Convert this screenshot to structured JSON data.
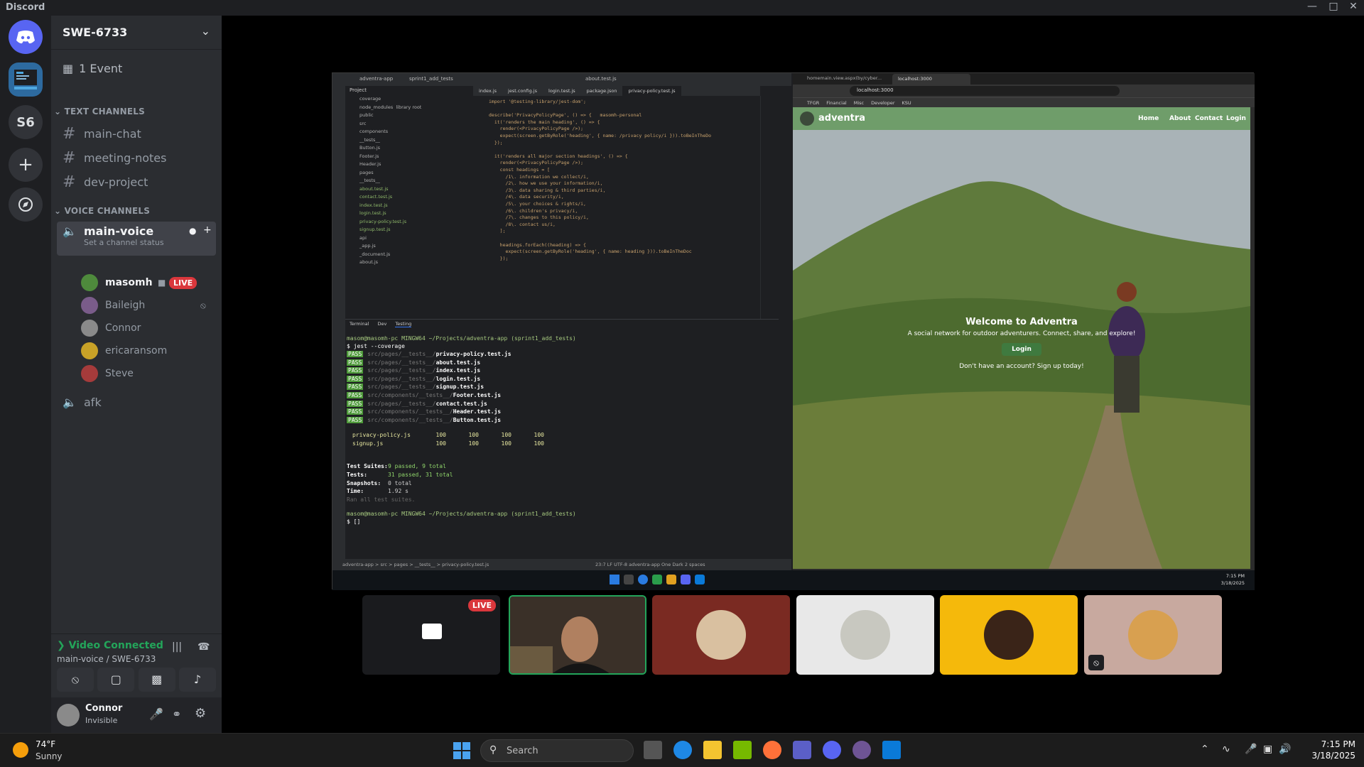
{
  "window": {
    "title": "Discord"
  },
  "server": {
    "name": "SWE-6733",
    "rail_label": "S6",
    "events": "1 Event"
  },
  "sidebar": {
    "text_category": "TEXT CHANNELS",
    "text_channels": [
      {
        "name": "main-chat"
      },
      {
        "name": "meeting-notes"
      },
      {
        "name": "dev-project"
      }
    ],
    "voice_category": "VOICE CHANNELS",
    "voice_channel": {
      "name": "main-voice",
      "status": "Set a channel status"
    },
    "members": [
      {
        "name": "masomh",
        "live": "LIVE",
        "color": "#4e8a3c"
      },
      {
        "name": "Baileigh",
        "color": "#7a5c8a"
      },
      {
        "name": "Connor",
        "color": "#8a8a8a"
      },
      {
        "name": "ericaransom",
        "color": "#c9a227"
      },
      {
        "name": "Steve",
        "color": "#a53b3b"
      }
    ],
    "afk_channel": "afk"
  },
  "voice": {
    "status": "Video Connected",
    "location": "main-voice / SWE-6733",
    "status_color": "#23a55a"
  },
  "user": {
    "name": "Connor",
    "status": "Invisible"
  },
  "ide": {
    "project": "adventra-app",
    "branch": "sprint1_add_tests",
    "run_config": "about.test.js",
    "tabs": [
      "index.js",
      "jest.config.js",
      "login.test.js",
      "package.json",
      "privacy-policy.test.js"
    ],
    "tree": [
      "coverage",
      "node_modules  library root",
      "public",
      "src",
      "components",
      "__tests__",
      "Button.js",
      "Footer.js",
      "Header.js",
      "pages",
      "__tests__",
      "about.test.js",
      "contact.test.js",
      "index.test.js",
      "login.test.js",
      "privacy-policy.test.js",
      "signup.test.js",
      "api",
      "_app.js",
      "_document.js",
      "about.js"
    ],
    "code": [
      "import '@testing-library/jest-dom';",
      "",
      "describe('PrivacyPolicyPage', () => {   masomh-personal",
      "  it('renders the main heading', () => {",
      "    render(<PrivacyPolicyPage />);",
      "    expect(screen.getByRole('heading', { name: /privacy policy/i })).toBeInTheDo",
      "  });",
      "",
      "  it('renders all major section headings', () => {",
      "    render(<PrivacyPolicyPage />);",
      "    const headings = [",
      "      /1\\. information we collect/i,",
      "      /2\\. how we use your information/i,",
      "      /3\\. data sharing & third parties/i,",
      "      /4\\. data security/i,",
      "      /5\\. your choices & rights/i,",
      "      /6\\. children's privacy/i,",
      "      /7\\. changes to this policy/i,",
      "      /8\\. contact us/i,",
      "    ];",
      "",
      "    headings.forEach((heading) => {",
      "      expect(screen.getByRole('heading', { name: heading })).toBeInTheDoc",
      "    });"
    ],
    "terminal_tabs": [
      "Terminal",
      "Dev",
      "Testing"
    ],
    "prompt": "masom@masomh-pc MINGW64 ~/Projects/adventra-app (sprint1_add_tests)",
    "command": "$ jest --coverage",
    "results": [
      {
        "status": "PASS",
        "path": "src/pages/__tests__/",
        "file": "privacy-policy.test.js"
      },
      {
        "status": "PASS",
        "path": "src/pages/__tests__/",
        "file": "about.test.js"
      },
      {
        "status": "PASS",
        "path": "src/pages/__tests__/",
        "file": "index.test.js"
      },
      {
        "status": "PASS",
        "path": "src/pages/__tests__/",
        "file": "login.test.js"
      },
      {
        "status": "PASS",
        "path": "src/pages/__tests__/",
        "file": "signup.test.js"
      },
      {
        "status": "PASS",
        "path": "src/components/__tests__/",
        "file": "Footer.test.js"
      },
      {
        "status": "PASS",
        "path": "src/pages/__tests__/",
        "file": "contact.test.js"
      },
      {
        "status": "PASS",
        "path": "src/components/__tests__/",
        "file": "Header.test.js"
      },
      {
        "status": "PASS",
        "path": "src/components/__tests__/",
        "file": "Button.test.js"
      }
    ],
    "coverage": [
      {
        "file": "privacy-policy.js",
        "vals": [
          "100",
          "100",
          "100",
          "100"
        ]
      },
      {
        "file": "signup.js",
        "vals": [
          "100",
          "100",
          "100",
          "100"
        ]
      }
    ],
    "summary": [
      {
        "label": "Test Suites:",
        "value": "9 passed, 9 total"
      },
      {
        "label": "Tests:",
        "value": "31 passed, 31 total"
      },
      {
        "label": "Snapshots:",
        "value": "0 total"
      },
      {
        "label": "Time:",
        "value": "1.92 s"
      }
    ],
    "ran_all": "Ran all test suites.",
    "prompt2": "masom@masomh-pc MINGW64 ~/Projects/adventra-app (sprint1_add_tests)",
    "prompt2_cmd": "$ []",
    "breadcrumb": "adventra-app  >  src  >  pages  >  __tests__  >  privacy-policy.test.js",
    "status_right": "23:7   LF   UTF-8   adventra-app   One Dark   2 spaces"
  },
  "browser": {
    "tabs": [
      "homemain.view.aspx(by/cyber...",
      "localhost:3000"
    ],
    "url": "localhost:3000",
    "bookmarks": [
      "TFGR",
      "Financial",
      "Misc",
      "Developer",
      "KSU"
    ],
    "site": {
      "brand": "adventra",
      "nav": [
        "Home",
        "About",
        "Contact",
        "Login"
      ],
      "hero_title": "Welcome to Adventra",
      "hero_sub": "A social network for outdoor adventurers. Connect, share, and explore!",
      "hero_btn": "Login",
      "hero_footer": "Don't have an account? Sign up today!"
    }
  },
  "shared_taskbar": {
    "time": "7:15 PM",
    "date": "3/18/2025"
  },
  "tiles": [
    {
      "name": "screen-share",
      "live": "LIVE"
    },
    {
      "name": "camera"
    },
    {
      "name": "avatar-1",
      "bg": "#7a2a22"
    },
    {
      "name": "avatar-2",
      "bg": "#e8e8e8"
    },
    {
      "name": "avatar-3",
      "bg": "#f5b90b"
    },
    {
      "name": "avatar-4",
      "bg": "#c8a99f"
    }
  ],
  "taskbar": {
    "weather_temp": "74°F",
    "weather_desc": "Sunny",
    "search_placeholder": "Search",
    "time": "7:15 PM",
    "date": "3/18/2025"
  }
}
